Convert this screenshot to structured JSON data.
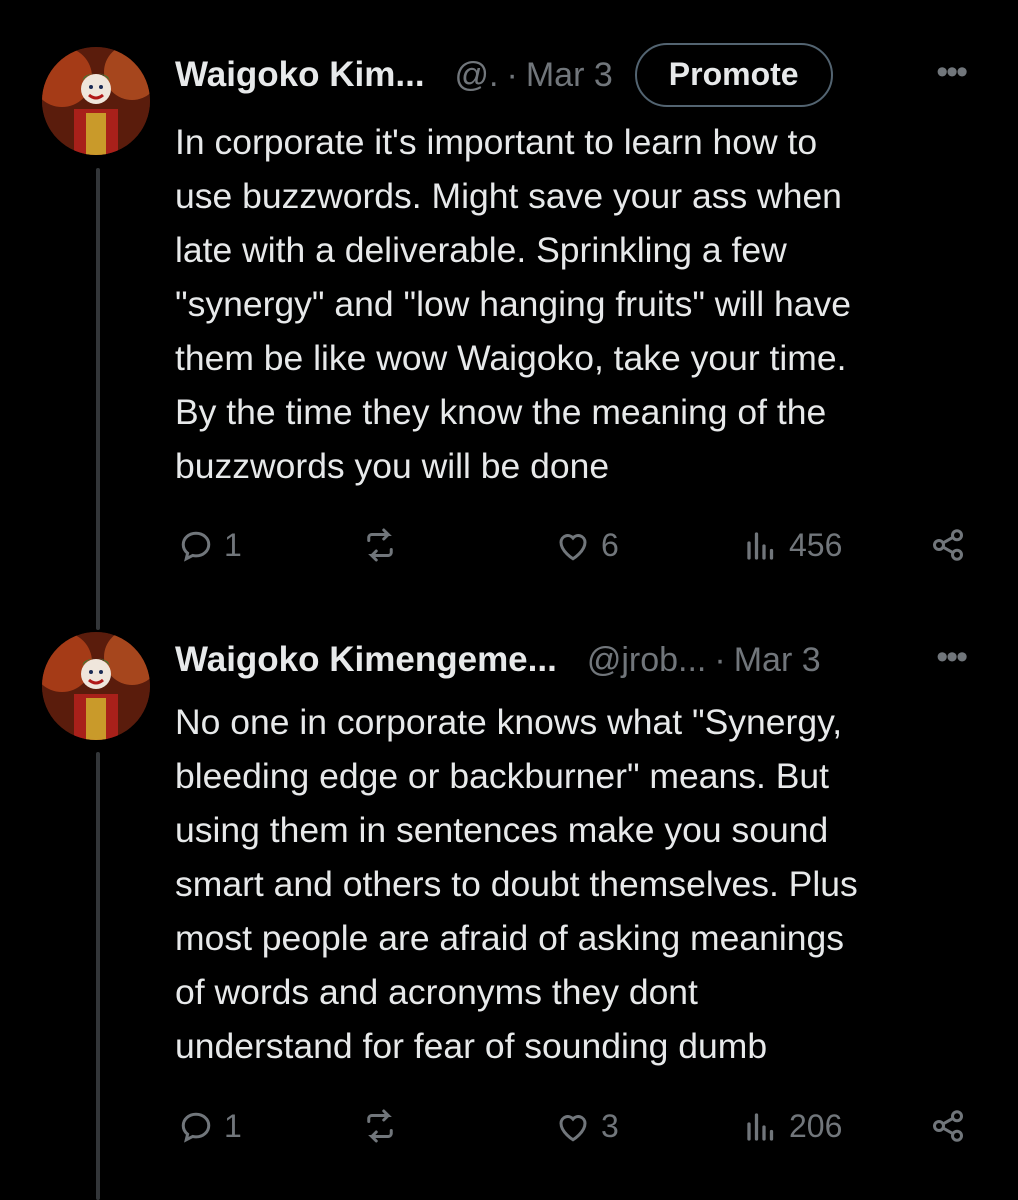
{
  "tweets": [
    {
      "name": "Waigoko Kim...",
      "handle": "@.",
      "dot": "·",
      "date": "Mar 3",
      "promote_label": "Promote",
      "more_label": "•••",
      "text": "In corporate it's important to learn how to\nuse buzzwords. Might save your ass when\nlate with a deliverable. Sprinkling a few\n\"synergy\" and \"low hanging fruits\" will have\nthem be like wow Waigoko, take your time.\nBy the time they know the meaning of the\nbuzzwords you will be done",
      "replies": "1",
      "reposts": "",
      "likes": "6",
      "views": "456"
    },
    {
      "name": "Waigoko Kimengeme...",
      "handle": "@jrob...",
      "dot": "·",
      "date": "Mar 3",
      "more_label": "•••",
      "text": "No one in corporate knows what \"Synergy,\nbleeding edge or backburner\" means. But\nusing them in sentences make you sound\nsmart and others to doubt themselves. Plus\nmost people are afraid of asking meanings\nof words and acronyms they dont\nunderstand for fear of sounding dumb",
      "replies": "1",
      "reposts": "",
      "likes": "3",
      "views": "206"
    }
  ],
  "icons": {
    "reply": "reply-icon",
    "repost": "repost-icon",
    "like": "heart-icon",
    "views": "views-icon",
    "share": "share-icon"
  },
  "colors": {
    "background": "#000000",
    "text": "#e7e9ea",
    "muted": "#71767b",
    "thread_line": "#333639"
  }
}
